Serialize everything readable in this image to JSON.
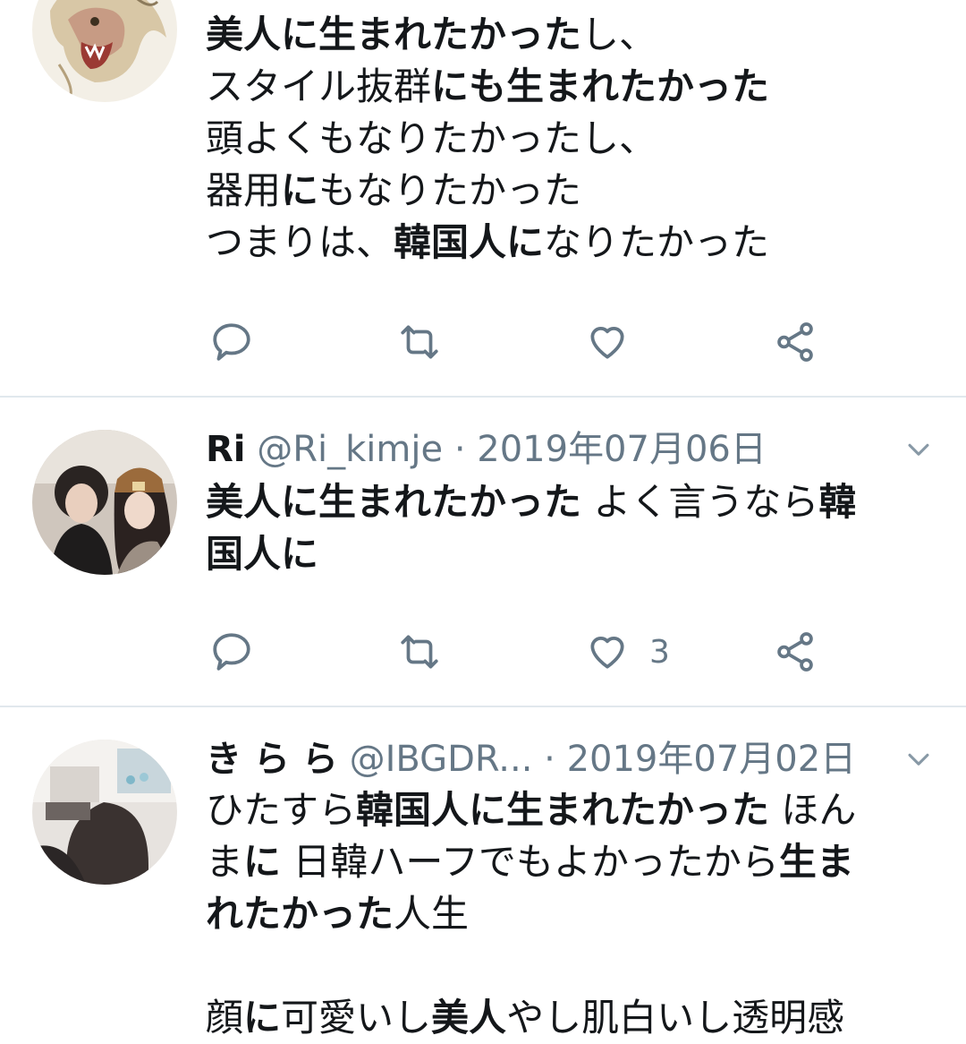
{
  "tweets": [
    {
      "lines": [
        [
          {
            "t": "美人に生まれたかった",
            "b": true
          },
          {
            "t": "し、",
            "b": false
          }
        ],
        [
          {
            "t": "スタイル抜群",
            "b": false
          },
          {
            "t": "にも生まれたかった",
            "b": true
          }
        ],
        [
          {
            "t": "頭よくもなりたかったし、",
            "b": false
          }
        ],
        [
          {
            "t": "器用",
            "b": false
          },
          {
            "t": "に",
            "b": true
          },
          {
            "t": "もなりたかった",
            "b": false
          }
        ],
        [
          {
            "t": "つまりは、",
            "b": false
          },
          {
            "t": "韓国人に",
            "b": true
          },
          {
            "t": "なりたかった",
            "b": false
          }
        ]
      ],
      "like_count": ""
    },
    {
      "name": "Ri",
      "handle": "@Ri_kimje",
      "dot": "·",
      "date": "2019年07月06日",
      "lines": [
        [
          {
            "t": "美人に生まれたかった",
            "b": true
          },
          {
            "t": " よく言うなら",
            "b": false
          },
          {
            "t": "韓",
            "b": true
          }
        ],
        [
          {
            "t": "国人に",
            "b": true
          }
        ]
      ],
      "like_count": "3"
    },
    {
      "name": "き ら ら",
      "handle": "@IBGDR...",
      "dot": "·",
      "date": "2019年07月02日",
      "lines": [
        [
          {
            "t": "ひたすら",
            "b": false
          },
          {
            "t": "韓国人に生まれたかった",
            "b": true
          },
          {
            "t": " ほん",
            "b": false
          }
        ],
        [
          {
            "t": "ま",
            "b": false
          },
          {
            "t": "に",
            "b": true
          },
          {
            "t": " 日韓ハーフでもよかったから",
            "b": false
          },
          {
            "t": "生ま",
            "b": true
          }
        ],
        [
          {
            "t": "れたかった",
            "b": true
          },
          {
            "t": "人生",
            "b": false
          }
        ],
        [],
        [
          {
            "t": " 顔",
            "b": false
          },
          {
            "t": "に",
            "b": true
          },
          {
            "t": "可愛いし",
            "b": false
          },
          {
            "t": "美人",
            "b": true
          },
          {
            "t": "やし肌白いし透明感",
            "b": false
          }
        ]
      ]
    }
  ],
  "icons": {
    "reply": "reply-icon",
    "retweet": "retweet-icon",
    "like": "heart-icon",
    "share": "share-icon",
    "more": "chevron-down-icon"
  },
  "colors": {
    "icon_gray": "#657786",
    "divider": "#e1e8ed",
    "text": "#14171a"
  }
}
